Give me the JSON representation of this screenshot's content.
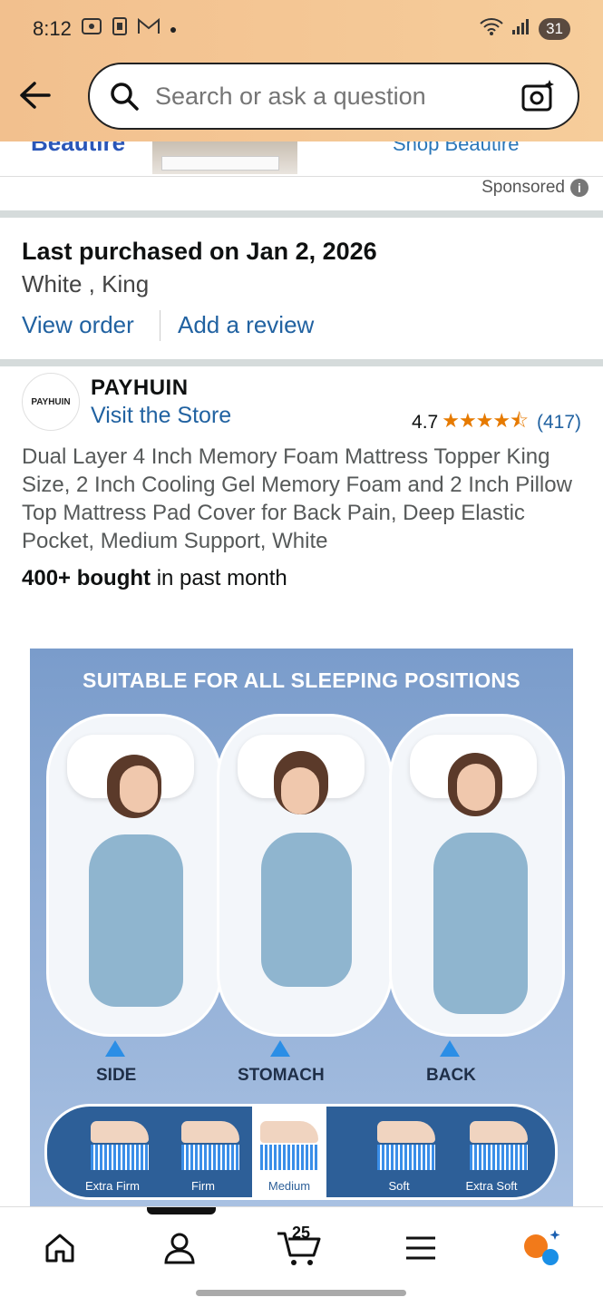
{
  "status_bar": {
    "time": "8:12",
    "battery": "31"
  },
  "search": {
    "placeholder": "Search or ask a question"
  },
  "ad": {
    "left_text": "Beautire",
    "right_text": "Shop Beautire",
    "sponsored": "Sponsored"
  },
  "purchase": {
    "title": "Last purchased on Jan 2, 2026",
    "variant": "White , King",
    "view_order": "View order",
    "add_review": "Add a review"
  },
  "brand": {
    "logo_text": "PAYHUIN",
    "name": "PAYHUIN",
    "store_link": "Visit the Store",
    "rating": "4.7",
    "stars": "★★★★⯪",
    "review_count": "(417)"
  },
  "product": {
    "title": "Dual Layer 4 Inch Memory Foam Mattress Topper King Size, 2 Inch Cooling Gel Memory Foam and 2 Inch Pillow Top Mattress Pad Cover for Back Pain, Deep Elastic Pocket, Medium Support, White",
    "bought_count": "400+ bought",
    "bought_suffix": " in past month"
  },
  "product_image": {
    "title": "SUITABLE FOR ALL SLEEPING POSITIONS",
    "positions": [
      "SIDE",
      "STOMACH",
      "BACK"
    ],
    "firmness": [
      "Extra Firm",
      "Firm",
      "Medium",
      "Soft",
      "Extra Soft"
    ],
    "selected_firmness": "Medium"
  },
  "nav": {
    "cart_count": "25"
  },
  "colors": {
    "header": "#f4c596",
    "link": "#2162a1",
    "star": "#e67a00"
  }
}
